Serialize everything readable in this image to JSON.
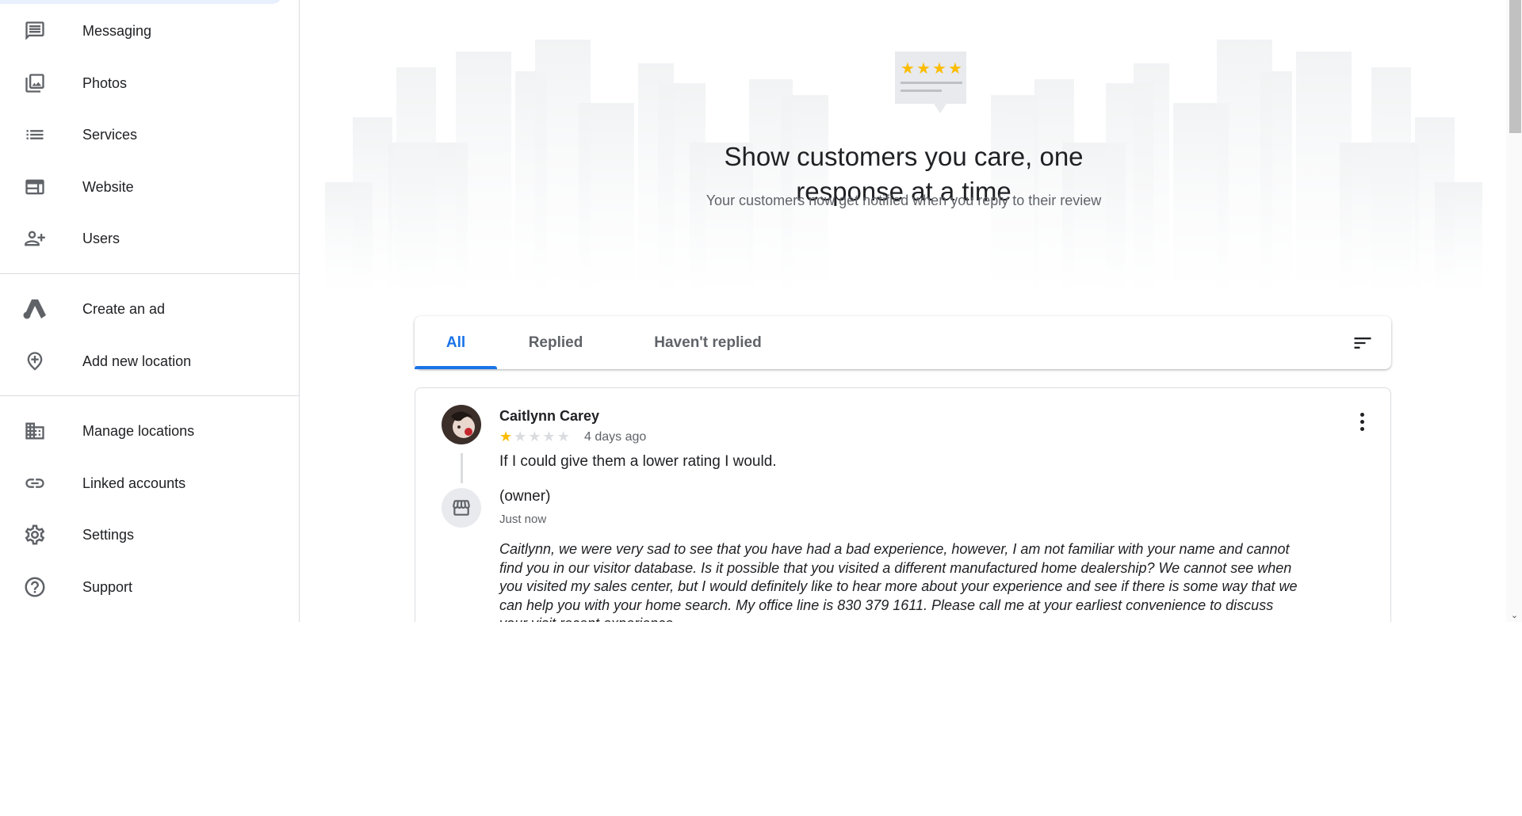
{
  "sidebar": {
    "items": [
      {
        "label": "Messaging",
        "icon": "message-icon"
      },
      {
        "label": "Photos",
        "icon": "photos-icon"
      },
      {
        "label": "Services",
        "icon": "list-icon"
      },
      {
        "label": "Website",
        "icon": "website-icon"
      },
      {
        "label": "Users",
        "icon": "add-user-icon"
      },
      {
        "label": "Create an ad",
        "icon": "google-ads-icon"
      },
      {
        "label": "Add new location",
        "icon": "add-location-icon"
      },
      {
        "label": "Manage locations",
        "icon": "building-icon"
      },
      {
        "label": "Linked accounts",
        "icon": "link-icon"
      },
      {
        "label": "Settings",
        "icon": "gear-icon"
      },
      {
        "label": "Support",
        "icon": "help-icon"
      }
    ]
  },
  "hero": {
    "title_line1": "Show customers you care, one",
    "title_line2": "response at a time",
    "subtitle": "Your customers now get notified when you reply to their review"
  },
  "tabs": {
    "all": "All",
    "replied": "Replied",
    "not_replied": "Haven't replied",
    "active": "All"
  },
  "review": {
    "name": "Caitlynn Carey",
    "rating": 1,
    "max_rating": 5,
    "time": "4 days ago",
    "text": "If I could give them a lower rating I would.",
    "owner_label": "(owner)",
    "owner_time": "Just now",
    "owner_reply": "Caitlynn, we were very sad to see that you have had a bad experience, however, I am not familiar with your name and cannot find you in our visitor database. Is it possible that you visited a different manufactured home dealership? We cannot see when you visited my sales center, but I would definitely like to hear more about your experience and see if there is some way that we can help you with your home search. My office line is 830 379 1611. Please call me at your earliest convenience to discuss your visit recent experience."
  },
  "colors": {
    "accent": "#1a73e8",
    "star": "#fbbc04",
    "divider": "#dadce0"
  }
}
